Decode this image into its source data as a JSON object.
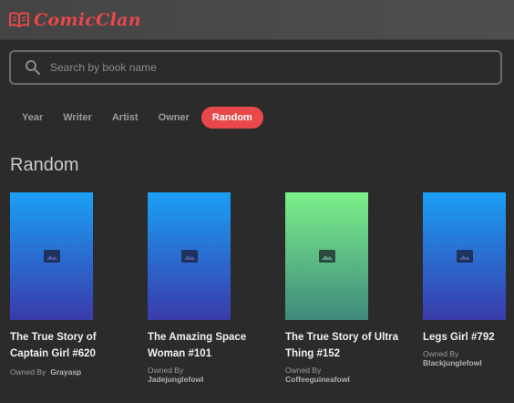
{
  "app": {
    "name": "ComicClan"
  },
  "search": {
    "placeholder": "Search by book name"
  },
  "tabs": [
    {
      "label": "Year"
    },
    {
      "label": "Writer"
    },
    {
      "label": "Artist"
    },
    {
      "label": "Owner"
    },
    {
      "label": "Random",
      "active": true
    }
  ],
  "section": {
    "title": "Random"
  },
  "books": [
    {
      "title": "The True Story of Captain Girl #620",
      "owned_label": "Owned By",
      "owner": "Grayasp"
    },
    {
      "title": "The Amazing Space Woman #101",
      "owned_label": "Owned By",
      "owner": "Jadejunglefowl"
    },
    {
      "title": "The True Story of Ultra Thing #152",
      "owned_label": "Owned By",
      "owner": "Coffeeguineafowl"
    },
    {
      "title": "Legs Girl #792",
      "owned_label": "Owned By",
      "owner": "Blackjunglefowl"
    }
  ],
  "colors": {
    "accent": "#e8484a",
    "background": "#2b2b2b",
    "topbar": "#4a4a4a"
  },
  "icons": {
    "logo": "book-open-icon",
    "search": "search-icon",
    "cover": "image-placeholder-icon"
  }
}
